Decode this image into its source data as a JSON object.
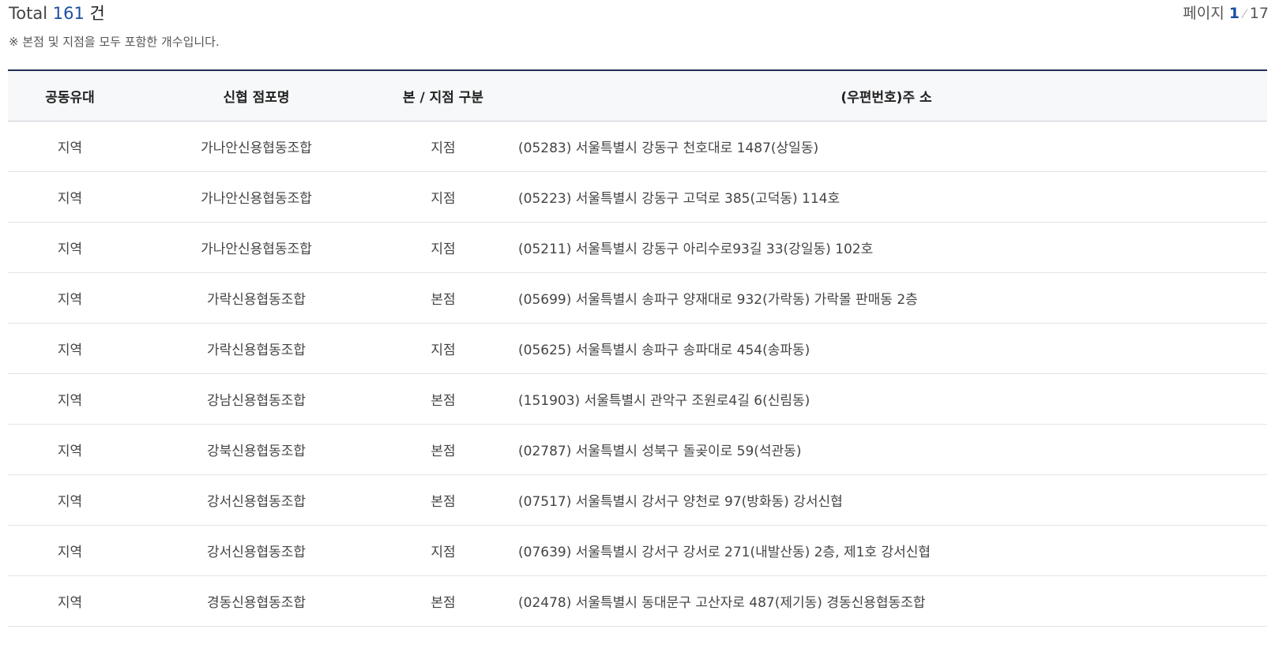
{
  "summary": {
    "total_label": "Total",
    "total_count": "161",
    "total_unit": "건",
    "note": "※ 본점 및 지점을 모두 포함한 개수입니다."
  },
  "pagination": {
    "label": "페이지",
    "current": "1",
    "separator": "⁄",
    "total": "17"
  },
  "table": {
    "headers": [
      "공동유대",
      "신협 점포명",
      "본 / 지점 구분",
      "(우편번호)주 소"
    ],
    "rows": [
      {
        "bond": "지역",
        "name": "가나안신용협동조합",
        "type": "지점",
        "address": "(05283) 서울특별시 강동구 천호대로 1487(상일동)"
      },
      {
        "bond": "지역",
        "name": "가나안신용협동조합",
        "type": "지점",
        "address": "(05223) 서울특별시 강동구 고덕로 385(고덕동) 114호"
      },
      {
        "bond": "지역",
        "name": "가나안신용협동조합",
        "type": "지점",
        "address": "(05211) 서울특별시 강동구 아리수로93길 33(강일동) 102호"
      },
      {
        "bond": "지역",
        "name": "가락신용협동조합",
        "type": "본점",
        "address": "(05699) 서울특별시 송파구 양재대로 932(가락동) 가락몰 판매동 2층"
      },
      {
        "bond": "지역",
        "name": "가락신용협동조합",
        "type": "지점",
        "address": "(05625) 서울특별시 송파구 송파대로 454(송파동)"
      },
      {
        "bond": "지역",
        "name": "강남신용협동조합",
        "type": "본점",
        "address": "(151903) 서울특별시 관악구 조원로4길 6(신림동)"
      },
      {
        "bond": "지역",
        "name": "강북신용협동조합",
        "type": "본점",
        "address": "(02787) 서울특별시 성북구 돌곶이로 59(석관동)"
      },
      {
        "bond": "지역",
        "name": "강서신용협동조합",
        "type": "본점",
        "address": "(07517) 서울특별시 강서구 양천로 97(방화동) 강서신협"
      },
      {
        "bond": "지역",
        "name": "강서신용협동조합",
        "type": "지점",
        "address": "(07639) 서울특별시 강서구 강서로 271(내발산동) 2층, 제1호 강서신협"
      },
      {
        "bond": "지역",
        "name": "경동신용협동조합",
        "type": "본점",
        "address": "(02478) 서울특별시 동대문구 고산자로 487(제기동) 경동신용협동조합"
      }
    ]
  }
}
